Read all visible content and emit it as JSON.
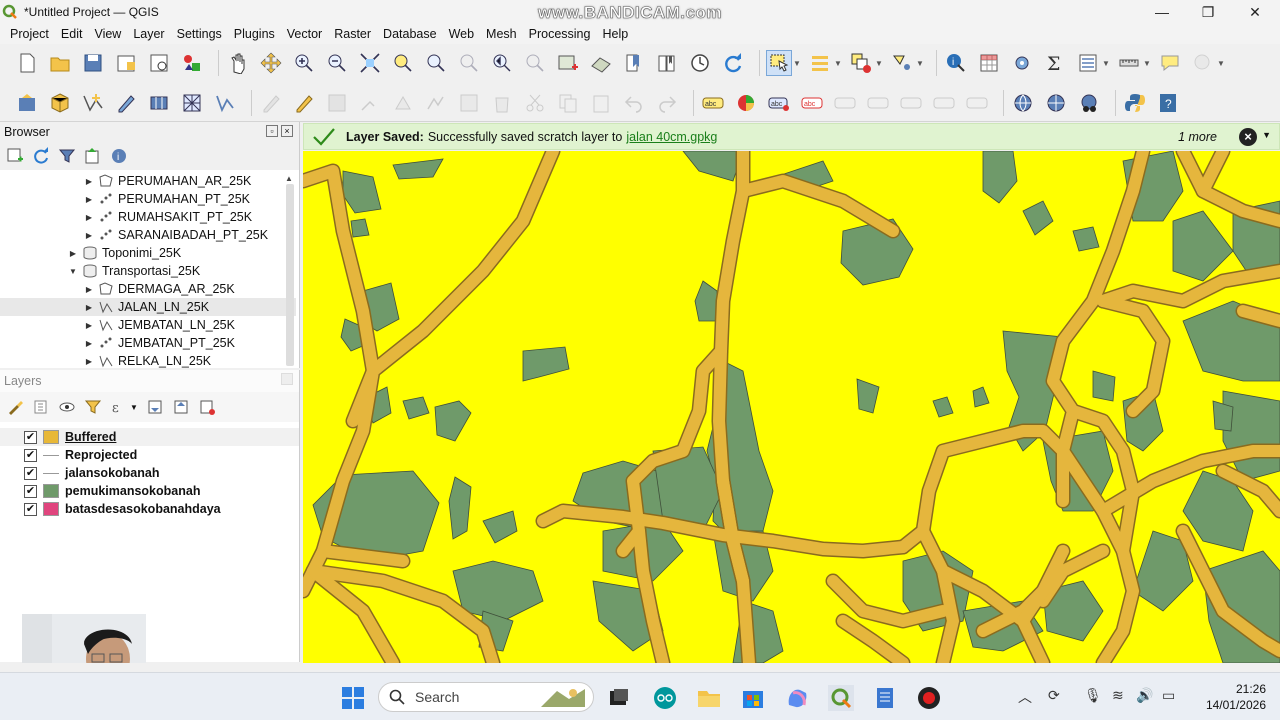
{
  "window": {
    "title": "*Untitled Project — QGIS",
    "watermark": "www.BANDICAM.com"
  },
  "menu": [
    "Project",
    "Edit",
    "View",
    "Layer",
    "Settings",
    "Plugins",
    "Vector",
    "Raster",
    "Database",
    "Web",
    "Mesh",
    "Processing",
    "Help"
  ],
  "browser": {
    "title": "Browser",
    "items": [
      {
        "label": "PERUMAHAN_AR_25K",
        "icon": "polygon-layer-icon",
        "indent": 2
      },
      {
        "label": "PERUMAHAN_PT_25K",
        "icon": "point-layer-icon",
        "indent": 2
      },
      {
        "label": "RUMAHSAKIT_PT_25K",
        "icon": "point-layer-icon",
        "indent": 2
      },
      {
        "label": "SARANAIBADAH_PT_25K",
        "icon": "point-layer-icon",
        "indent": 2
      },
      {
        "label": "Toponimi_25K",
        "icon": "database-icon",
        "indent": 1
      },
      {
        "label": "Transportasi_25K",
        "icon": "database-icon",
        "indent": 1,
        "expanded": true
      },
      {
        "label": "DERMAGA_AR_25K",
        "icon": "polygon-layer-icon",
        "indent": 2
      },
      {
        "label": "JALAN_LN_25K",
        "icon": "line-layer-icon",
        "indent": 2,
        "highlighted": true
      },
      {
        "label": "JEMBATAN_LN_25K",
        "icon": "line-layer-icon",
        "indent": 2
      },
      {
        "label": "JEMBATAN_PT_25K",
        "icon": "point-layer-icon",
        "indent": 2
      },
      {
        "label": "RELKA_LN_25K",
        "icon": "line-layer-icon",
        "indent": 2
      }
    ]
  },
  "layers": {
    "title": "Layers",
    "items": [
      {
        "label": "Buffered",
        "symbol": "fill",
        "color": "#e8b838",
        "checked": true,
        "selected": true
      },
      {
        "label": "Reprojected",
        "symbol": "line",
        "color": "#999999",
        "checked": true
      },
      {
        "label": "jalansokobanah",
        "symbol": "line",
        "color": "#999999",
        "checked": true
      },
      {
        "label": "pemukimansokobanah",
        "symbol": "fill",
        "color": "#6f9a6a",
        "checked": true
      },
      {
        "label": "batasdesasokobanahdaya",
        "symbol": "fill",
        "color": "#e0457e",
        "checked": true
      }
    ]
  },
  "message": {
    "title": "Layer Saved:",
    "text": "Successfully saved scratch layer to",
    "link": "jalan 40cm.gpkg",
    "more": "1 more"
  },
  "map": {
    "background": "#ffff00",
    "road_fill": "#e5b63d",
    "road_outline": "#8a6b1e",
    "settlement": "#6f9a6a"
  },
  "taskbar": {
    "search_label": "Search",
    "time": "21:26",
    "date": "14/01/2026"
  }
}
